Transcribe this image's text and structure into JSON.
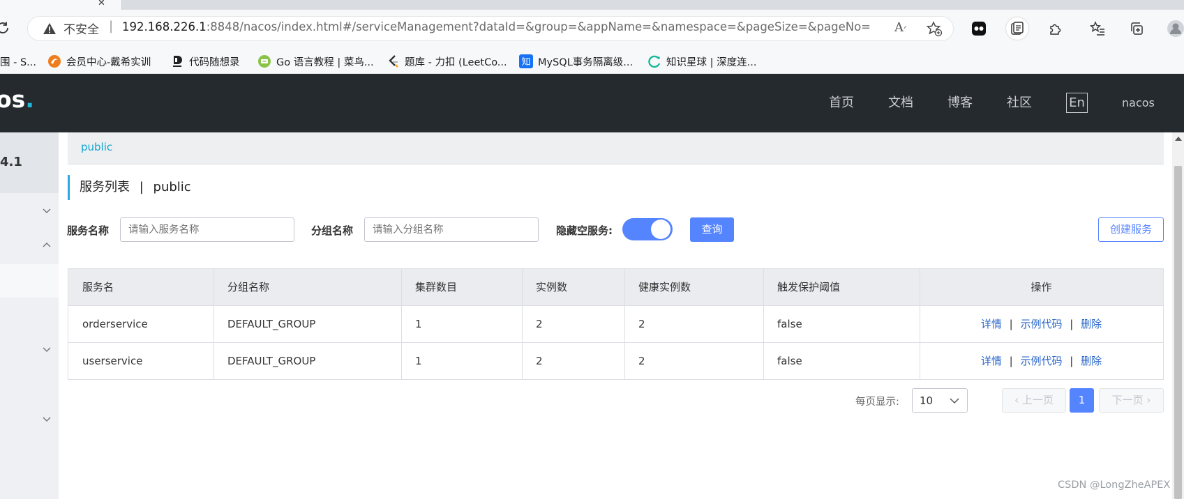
{
  "browser": {
    "tab_close": "✕",
    "security_label": "不安全",
    "url_host": "192.168.226.1",
    "url_rest": ":8848/nacos/index.html#/serviceManagement?dataId=&group=&appName=&namespace=&pageSize=&pageNo=",
    "bookmarks": [
      {
        "label": "围 - S...",
        "icon": "globe-icon",
        "color": "#888888"
      },
      {
        "label": "会员中心-戴希实训",
        "icon": "swirl-icon",
        "color": "#f07d1c"
      },
      {
        "label": "代码随想录",
        "icon": "d-logo-icon",
        "color": "#222222"
      },
      {
        "label": "Go 语言教程 | 菜鸟...",
        "icon": "runoob-icon",
        "color": "#7cb342"
      },
      {
        "label": "题库 - 力扣 (LeetCo...",
        "icon": "leetcode-icon",
        "color": "#333333"
      },
      {
        "label": "MySQL事务隔离级...",
        "icon": "zhihu-icon",
        "color": "#1772f6"
      },
      {
        "label": "知识星球 | 深度连...",
        "icon": "planet-icon",
        "color": "#16b998"
      }
    ]
  },
  "header": {
    "logo_text": "os",
    "logo_dot": ".",
    "nav": [
      "首页",
      "文档",
      "博客",
      "社区"
    ],
    "lang_button": "En",
    "user": "nacos"
  },
  "sidebar": {
    "version": "4.1"
  },
  "namespace_tab": "public",
  "page_title": {
    "main": "服务列表",
    "separator": "|",
    "namespace": "public"
  },
  "filters": {
    "service_name_label": "服务名称",
    "service_name_placeholder": "请输入服务名称",
    "group_name_label": "分组名称",
    "group_name_placeholder": "请输入分组名称",
    "hide_empty_label": "隐藏空服务:",
    "hide_empty_on": true,
    "query_button": "查询",
    "create_button": "创建服务"
  },
  "table": {
    "columns": [
      "服务名",
      "分组名称",
      "集群数目",
      "实例数",
      "健康实例数",
      "触发保护阈值",
      "操作"
    ],
    "rows": [
      {
        "service": "orderservice",
        "group": "DEFAULT_GROUP",
        "clusters": "1",
        "instances": "2",
        "healthy": "2",
        "threshold": "false"
      },
      {
        "service": "userservice",
        "group": "DEFAULT_GROUP",
        "clusters": "1",
        "instances": "2",
        "healthy": "2",
        "threshold": "false"
      }
    ],
    "actions": [
      "详情",
      "示例代码",
      "删除"
    ],
    "action_separator": "|"
  },
  "pagination": {
    "page_size_label": "每页显示:",
    "page_size": "10",
    "prev": "上一页",
    "current": "1",
    "next": "下一页"
  },
  "watermark": "CSDN @LongZheAPEX",
  "colors": {
    "header_bg": "#252a2f",
    "primary": "#5584ff",
    "link": "#2a67c9",
    "namespace": "#0fa5d0"
  }
}
